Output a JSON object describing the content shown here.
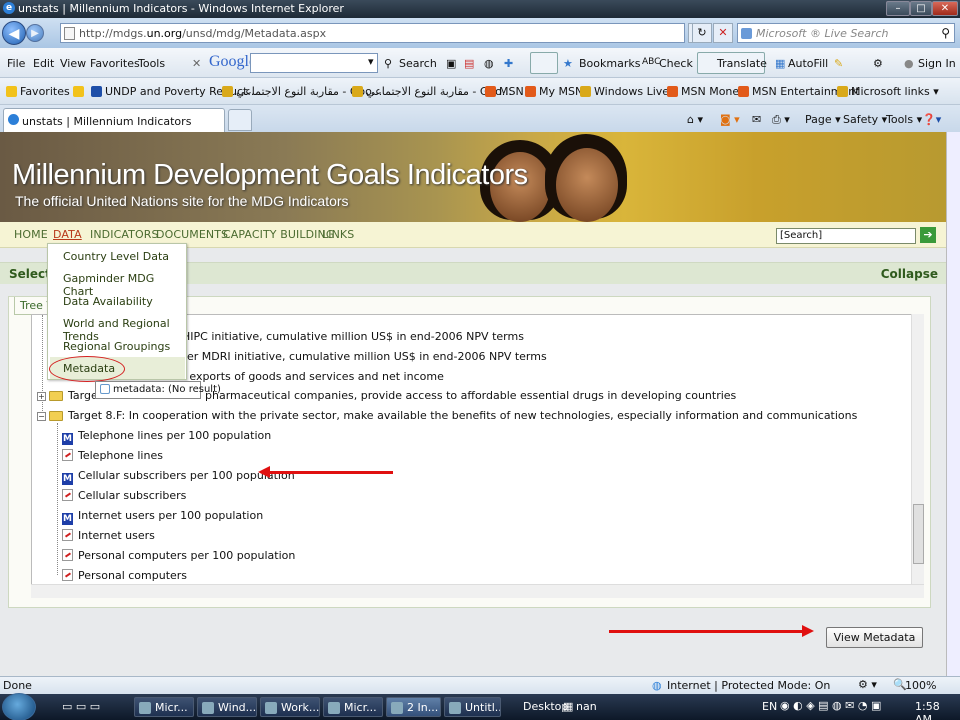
{
  "window": {
    "title": "unstats | Millennium Indicators - Windows Internet Explorer",
    "min_label": "–",
    "max_label": "□",
    "close_label": "✕"
  },
  "address_bar": {
    "url_prefix": "http://mdgs.",
    "url_domain": "un.org",
    "url_suffix": "/unsd/mdg/Metadata.aspx",
    "live_search_placeholder": "Microsoft ® Live Search"
  },
  "menu": {
    "items": [
      "File",
      "Edit",
      "View",
      "Favorites",
      "Tools"
    ]
  },
  "google_toolbar": {
    "logo": "Google",
    "search_label": "Search",
    "bookmarks_label": "Bookmarks",
    "check_label": "Check",
    "translate_label": "Translate",
    "autofill_label": "AutoFill",
    "signin_label": "Sign In"
  },
  "favorites_bar": {
    "favorites_label": "Favorites",
    "items": [
      "UNDP and Poverty Reduct...",
      "مقاربة النوع الاجتماعي - Goo...",
      "مقاربة النوع الاجتماعي - Goo...",
      "MSN",
      "My MSN",
      "Windows Live",
      "MSN Money",
      "MSN Entertainment",
      "Microsoft links"
    ]
  },
  "tabs": {
    "active_tab": "unstats | Millennium Indicators",
    "commands": [
      "Page",
      "Safety",
      "Tools"
    ]
  },
  "site": {
    "title": "Millennium Development Goals Indicators",
    "subtitle": "The official United Nations site for the MDG Indicators",
    "nav": [
      "HOME",
      "DATA",
      "INDICATORS",
      "DOCUMENTS",
      "CAPACITY BUILDING",
      "LINKS"
    ],
    "search_value": "[Search]",
    "go_label": "➔"
  },
  "select_bar": {
    "left_text": "Select S",
    "right_text": "Collapse"
  },
  "tree_view": {
    "tab_label": "Tree Vie",
    "rows": [
      "HIPC initiative, cumulative million US$ in end-2006 NPV terms",
      "der MDRI initiative, cumulative million US$ in end-2006 NPV terms",
      "f exports of goods and services and net income",
      "Target",
      "pharmaceutical companies, provide access to affordable essential drugs in developing countries",
      "Target 8.F: In cooperation with the private sector, make available the benefits of new technologies, especially information and communications",
      "Telephone lines per 100 population",
      "Telephone lines",
      "Cellular subscribers per 100 population",
      "Cellular subscribers",
      "Internet users per 100 population",
      "Internet users",
      "Personal computers per 100 population",
      "Personal computers"
    ],
    "expander_plus": "+",
    "expander_minus": "−",
    "metadata_glyph": "M"
  },
  "data_menu": {
    "items": [
      "Country Level Data",
      "Gapminder MDG Chart",
      "Data Availability",
      "World and Regional Trends",
      "Regional Groupings",
      "Metadata"
    ],
    "tooltip": "metadata: (No result)"
  },
  "buttons": {
    "view_metadata": "View Metadata"
  },
  "status_bar": {
    "left": "Done",
    "zone": "Internet | Protected Mode: On",
    "zoom": "100%"
  },
  "taskbar": {
    "tasks": [
      "Micr...",
      "Wind...",
      "Work...",
      "Micr...",
      "2 In...",
      "Untitl..."
    ],
    "desktop_label": "Desktop",
    "nan_label": "nan",
    "lang": "EN",
    "clock": "1:58 AM"
  },
  "colors": {
    "site_green": "#2f5a1d",
    "nav_green": "#4b6b30",
    "annotation_red": "#e01010"
  }
}
